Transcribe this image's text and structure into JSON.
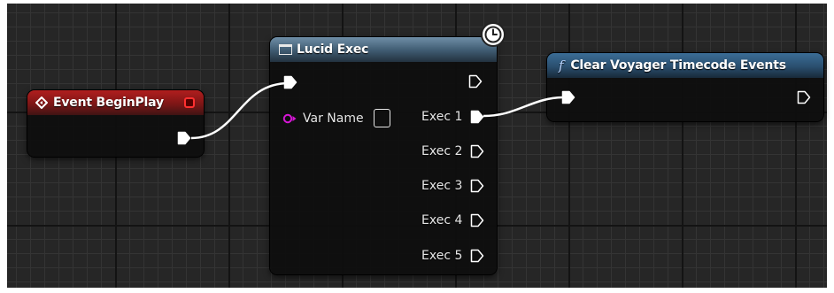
{
  "graph": {
    "background": "#262626",
    "wire_color": "#ffffff"
  },
  "nodes": {
    "begin_play": {
      "title": "Event BeginPlay",
      "icon": "event-diamond-icon",
      "header_color": "#8a1a1a"
    },
    "lucid_exec": {
      "title": "Lucid Exec",
      "icon": "window-icon",
      "header_color": "#4d6b82",
      "latent_icon": "clock-icon",
      "inputs": [
        {
          "label": "Var Name",
          "pin": "variable-pin",
          "pin_color": "#d616d6"
        }
      ],
      "outputs": [
        {
          "label": "Exec 1",
          "connected": true
        },
        {
          "label": "Exec 2",
          "connected": false
        },
        {
          "label": "Exec 3",
          "connected": false
        },
        {
          "label": "Exec 4",
          "connected": false
        },
        {
          "label": "Exec 5",
          "connected": false
        }
      ]
    },
    "clear_voyager": {
      "title": "Clear Voyager Timecode Events",
      "icon": "function-icon",
      "icon_glyph": "f",
      "header_color": "#2f587a"
    }
  }
}
